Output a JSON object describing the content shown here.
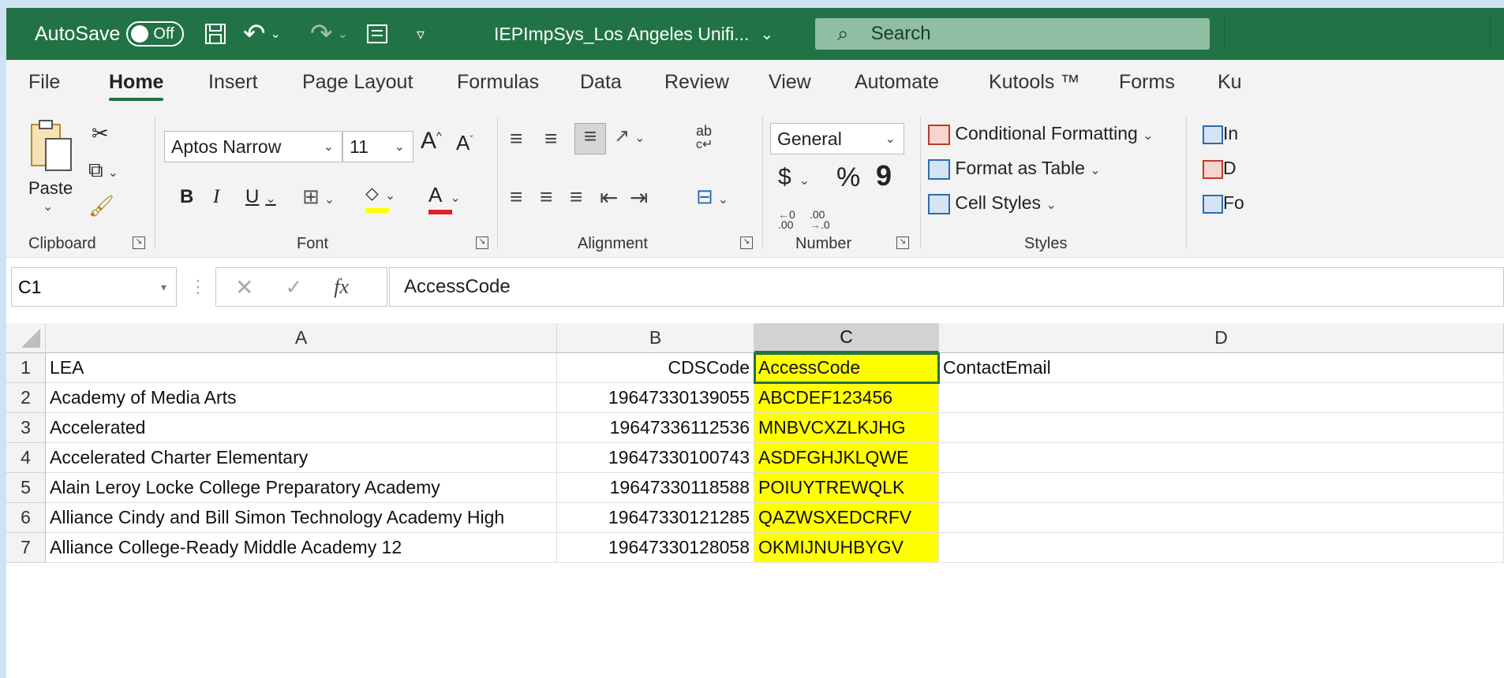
{
  "titlebar": {
    "autosave_label": "AutoSave",
    "autosave_state": "Off",
    "filename": "IEPImpSys_Los Angeles Unifi...",
    "search_placeholder": "Search"
  },
  "menu": [
    "File",
    "Home",
    "Insert",
    "Page Layout",
    "Formulas",
    "Data",
    "Review",
    "View",
    "Automate",
    "Kutools ™",
    "Forms",
    "Ku"
  ],
  "ribbon": {
    "clipboard": {
      "paste_label": "Paste",
      "group_label": "Clipboard"
    },
    "font": {
      "font_name": "Aptos Narrow",
      "font_size": "11",
      "bold": "B",
      "italic": "I",
      "underline": "U",
      "font_color_glyph": "A",
      "group_label": "Font"
    },
    "alignment": {
      "wrap_glyph": "ab",
      "group_label": "Alignment"
    },
    "number": {
      "format": "General",
      "currency": "$",
      "percent": "%",
      "comma": "9",
      "group_label": "Number"
    },
    "styles": {
      "conditional": "Conditional Formatting",
      "table": "Format as Table",
      "cell_styles": "Cell Styles",
      "group_label": "Styles"
    },
    "cells": {
      "insert": "In",
      "delete": "D",
      "format": "Fo"
    }
  },
  "formula_bar": {
    "name_box": "C1",
    "fx": "fx",
    "content": "AccessCode"
  },
  "grid": {
    "columns": [
      "A",
      "B",
      "C",
      "D"
    ],
    "rows": [
      {
        "n": "1",
        "A": "LEA",
        "B": "CDSCode",
        "C": "AccessCode",
        "D": "ContactEmail"
      },
      {
        "n": "2",
        "A": "Academy of Media Arts",
        "B": "19647330139055",
        "C": "ABCDEF123456",
        "D": ""
      },
      {
        "n": "3",
        "A": "Accelerated",
        "B": "19647336112536",
        "C": "MNBVCXZLKJHG",
        "D": ""
      },
      {
        "n": "4",
        "A": "Accelerated Charter Elementary",
        "B": "19647330100743",
        "C": "ASDFGHJKLQWE",
        "D": ""
      },
      {
        "n": "5",
        "A": "Alain Leroy Locke College Preparatory Academy",
        "B": "19647330118588",
        "C": "POIUYTREWQLK",
        "D": ""
      },
      {
        "n": "6",
        "A": "Alliance Cindy and Bill Simon Technology Academy High",
        "B": "19647330121285",
        "C": "QAZWSXEDCRFV",
        "D": ""
      },
      {
        "n": "7",
        "A": "Alliance College-Ready Middle Academy 12",
        "B": "19647330128058",
        "C": "OKMIJNUHBYGV",
        "D": ""
      }
    ]
  },
  "colors": {
    "excel_green": "#217346",
    "highlight": "#ffff00"
  }
}
